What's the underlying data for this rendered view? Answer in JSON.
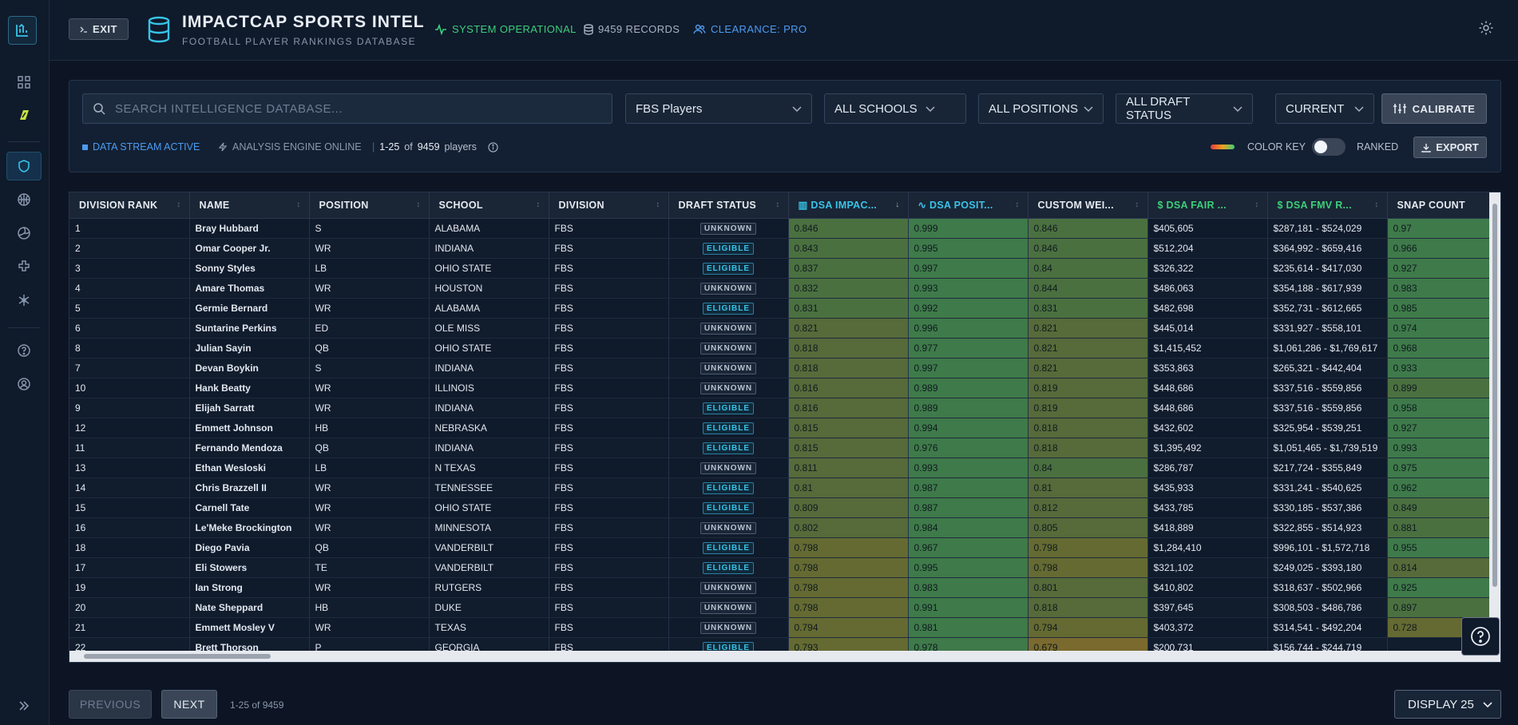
{
  "header": {
    "exit_label": "EXIT",
    "title": "IMPACTCAP SPORTS INTEL",
    "subtitle": "FOOTBALL PLAYER RANKINGS DATABASE",
    "system_status": "SYSTEM OPERATIONAL",
    "records": "9459 RECORDS",
    "clearance": "CLEARANCE: PRO"
  },
  "sidebar": {
    "icons": [
      "logo-icon",
      "grid-icon",
      "brand-icon",
      "shield-icon",
      "basketball-icon",
      "volleyball-icon",
      "puzzle-icon",
      "snowflake-icon",
      "help-icon",
      "user-icon",
      "expand-icon"
    ]
  },
  "filters": {
    "search_placeholder": "SEARCH INTELLIGENCE DATABASE...",
    "player_set": "FBS Players",
    "schools": "ALL SCHOOLS",
    "positions": "ALL POSITIONS",
    "draft_status": "ALL DRAFT STATUS",
    "period": "CURRENT",
    "calibrate_label": "CALIBRATE",
    "stream_status": "DATA STREAM ACTIVE",
    "engine_status": "ANALYSIS ENGINE ONLINE",
    "range": "1-25",
    "of": "of",
    "total": "9459",
    "unit": "players",
    "color_key_label": "COLOR KEY",
    "ranked_label": "RANKED",
    "export_label": "EXPORT"
  },
  "colors": {
    "accent": "#38c3e8",
    "ok": "#3ccf7a",
    "clearance": "#4c9bf0",
    "heat_high": "#3f7a4a",
    "heat_mid": "#5f6f3a",
    "heat_low": "#7a6a2e"
  },
  "table": {
    "columns": [
      "DIVISION RANK",
      "NAME",
      "POSITION",
      "SCHOOL",
      "DIVISION",
      "DRAFT STATUS",
      "DSA IMPAC...",
      "DSA POSIT...",
      "CUSTOM WEI...",
      "DSA FAIR ...",
      "DSA FMV R...",
      "SNAP COUNT"
    ],
    "rows": [
      [
        "1",
        "Bray Hubbard",
        "S",
        "ALABAMA",
        "FBS",
        "UNKNOWN",
        "0.846",
        "0.999",
        "0.846",
        "$405,605",
        "$287,181 - $524,029",
        "0.97"
      ],
      [
        "2",
        "Omar Cooper Jr.",
        "WR",
        "INDIANA",
        "FBS",
        "ELIGIBLE",
        "0.843",
        "0.995",
        "0.846",
        "$512,204",
        "$364,992 - $659,416",
        "0.966"
      ],
      [
        "3",
        "Sonny Styles",
        "LB",
        "OHIO STATE",
        "FBS",
        "ELIGIBLE",
        "0.837",
        "0.997",
        "0.84",
        "$326,322",
        "$235,614 - $417,030",
        "0.927"
      ],
      [
        "4",
        "Amare Thomas",
        "WR",
        "HOUSTON",
        "FBS",
        "UNKNOWN",
        "0.832",
        "0.993",
        "0.844",
        "$486,063",
        "$354,188 - $617,939",
        "0.983"
      ],
      [
        "5",
        "Germie Bernard",
        "WR",
        "ALABAMA",
        "FBS",
        "ELIGIBLE",
        "0.831",
        "0.992",
        "0.831",
        "$482,698",
        "$352,731 - $612,665",
        "0.985"
      ],
      [
        "6",
        "Suntarine Perkins",
        "ED",
        "OLE MISS",
        "FBS",
        "UNKNOWN",
        "0.821",
        "0.996",
        "0.821",
        "$445,014",
        "$331,927 - $558,101",
        "0.974"
      ],
      [
        "8",
        "Julian Sayin",
        "QB",
        "OHIO STATE",
        "FBS",
        "UNKNOWN",
        "0.818",
        "0.977",
        "0.821",
        "$1,415,452",
        "$1,061,286 - $1,769,617",
        "0.968"
      ],
      [
        "7",
        "Devan Boykin",
        "S",
        "INDIANA",
        "FBS",
        "UNKNOWN",
        "0.818",
        "0.997",
        "0.821",
        "$353,863",
        "$265,321 - $442,404",
        "0.933"
      ],
      [
        "10",
        "Hank Beatty",
        "WR",
        "ILLINOIS",
        "FBS",
        "UNKNOWN",
        "0.816",
        "0.989",
        "0.819",
        "$448,686",
        "$337,516 - $559,856",
        "0.899"
      ],
      [
        "9",
        "Elijah Sarratt",
        "WR",
        "INDIANA",
        "FBS",
        "ELIGIBLE",
        "0.816",
        "0.989",
        "0.819",
        "$448,686",
        "$337,516 - $559,856",
        "0.958"
      ],
      [
        "12",
        "Emmett Johnson",
        "HB",
        "NEBRASKA",
        "FBS",
        "ELIGIBLE",
        "0.815",
        "0.994",
        "0.818",
        "$432,602",
        "$325,954 - $539,251",
        "0.927"
      ],
      [
        "11",
        "Fernando Mendoza",
        "QB",
        "INDIANA",
        "FBS",
        "ELIGIBLE",
        "0.815",
        "0.976",
        "0.818",
        "$1,395,492",
        "$1,051,465 - $1,739,519",
        "0.993"
      ],
      [
        "13",
        "Ethan Wesloski",
        "LB",
        "N TEXAS",
        "FBS",
        "UNKNOWN",
        "0.811",
        "0.993",
        "0.84",
        "$286,787",
        "$217,724 - $355,849",
        "0.975"
      ],
      [
        "14",
        "Chris Brazzell II",
        "WR",
        "TENNESSEE",
        "FBS",
        "ELIGIBLE",
        "0.81",
        "0.987",
        "0.81",
        "$435,933",
        "$331,241 - $540,625",
        "0.962"
      ],
      [
        "15",
        "Carnell Tate",
        "WR",
        "OHIO STATE",
        "FBS",
        "ELIGIBLE",
        "0.809",
        "0.987",
        "0.812",
        "$433,785",
        "$330,185 - $537,386",
        "0.849"
      ],
      [
        "16",
        "Le'Meke Brockington",
        "WR",
        "MINNESOTA",
        "FBS",
        "UNKNOWN",
        "0.802",
        "0.984",
        "0.805",
        "$418,889",
        "$322,855 - $514,923",
        "0.881"
      ],
      [
        "18",
        "Diego Pavia",
        "QB",
        "VANDERBILT",
        "FBS",
        "ELIGIBLE",
        "0.798",
        "0.967",
        "0.798",
        "$1,284,410",
        "$996,101 - $1,572,718",
        "0.955"
      ],
      [
        "17",
        "Eli Stowers",
        "TE",
        "VANDERBILT",
        "FBS",
        "ELIGIBLE",
        "0.798",
        "0.995",
        "0.798",
        "$321,102",
        "$249,025 - $393,180",
        "0.814"
      ],
      [
        "19",
        "Ian Strong",
        "WR",
        "RUTGERS",
        "FBS",
        "UNKNOWN",
        "0.798",
        "0.983",
        "0.801",
        "$410,802",
        "$318,637 - $502,966",
        "0.925"
      ],
      [
        "20",
        "Nate Sheppard",
        "HB",
        "DUKE",
        "FBS",
        "UNKNOWN",
        "0.798",
        "0.991",
        "0.818",
        "$397,645",
        "$308,503 - $486,786",
        "0.897"
      ],
      [
        "21",
        "Emmett Mosley V",
        "WR",
        "TEXAS",
        "FBS",
        "UNKNOWN",
        "0.794",
        "0.981",
        "0.794",
        "$403,372",
        "$314,541 - $492,204",
        "0.728"
      ],
      [
        "22",
        "Brett Thorson",
        "P",
        "GEORGIA",
        "FBS",
        "ELIGIBLE",
        "0.793",
        "0.978",
        "0.679",
        "$200,731",
        "$156,744 - $244,719",
        "--"
      ]
    ]
  },
  "pagination": {
    "previous_label": "PREVIOUS",
    "next_label": "NEXT",
    "info": "1-25 of 9459",
    "display_label": "DISPLAY 25"
  }
}
